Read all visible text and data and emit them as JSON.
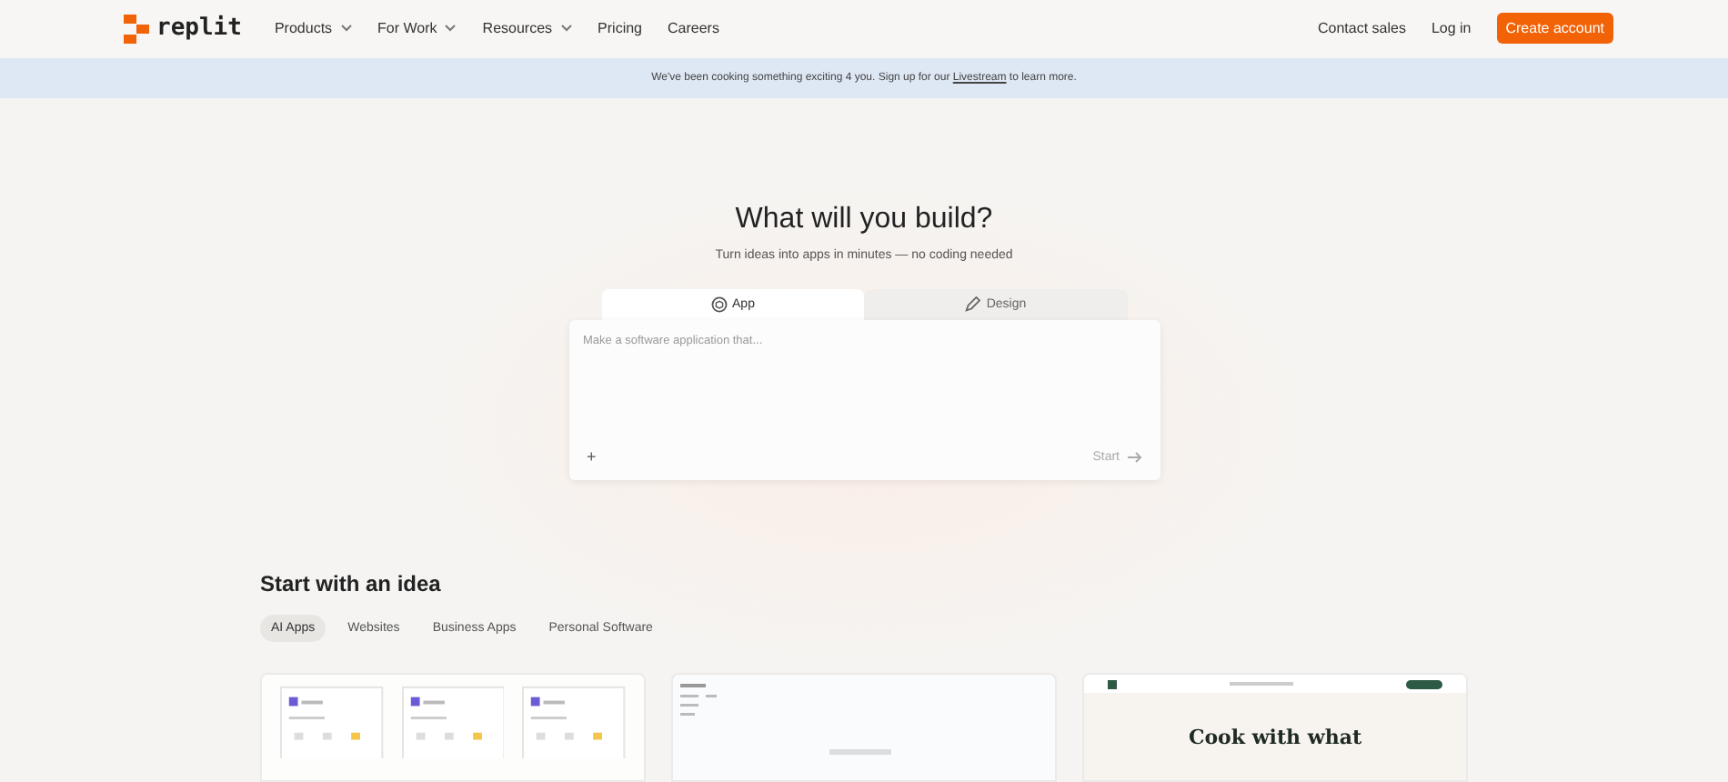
{
  "nav": {
    "brand": "replit",
    "links": [
      {
        "label": "Products",
        "dropdown": true
      },
      {
        "label": "For Work",
        "dropdown": true
      },
      {
        "label": "Resources",
        "dropdown": true
      },
      {
        "label": "Pricing",
        "dropdown": false
      },
      {
        "label": "Careers",
        "dropdown": false
      }
    ],
    "right": [
      {
        "label": "Contact sales",
        "kind": "link"
      },
      {
        "label": "Log in",
        "kind": "link"
      },
      {
        "label": "Create account",
        "kind": "primary"
      }
    ]
  },
  "banner": {
    "before": "We've been cooking something exciting 4 you. Sign up for our",
    "link": "Livestream",
    "after": "to learn more."
  },
  "hero": {
    "title": "What will you build?",
    "subtitle": "Turn ideas into apps in minutes — no coding needed",
    "tabs": [
      {
        "label": "App",
        "selected": true
      },
      {
        "label": "Design",
        "selected": false
      }
    ],
    "prompt": {
      "placeholder": "Make a software application that..."
    },
    "attach": "+",
    "start": "Start"
  },
  "ideas": {
    "title": "Start with an idea",
    "chips": [
      {
        "label": "AI Apps",
        "selected": true
      },
      {
        "label": "Websites",
        "selected": false
      },
      {
        "label": "Business Apps",
        "selected": false
      },
      {
        "label": "Personal Software",
        "selected": false
      }
    ],
    "cards": [
      {
        "kind": "phones"
      },
      {
        "kind": "dashboard"
      },
      {
        "kind": "recipe",
        "heading": "Cook with what"
      }
    ]
  }
}
